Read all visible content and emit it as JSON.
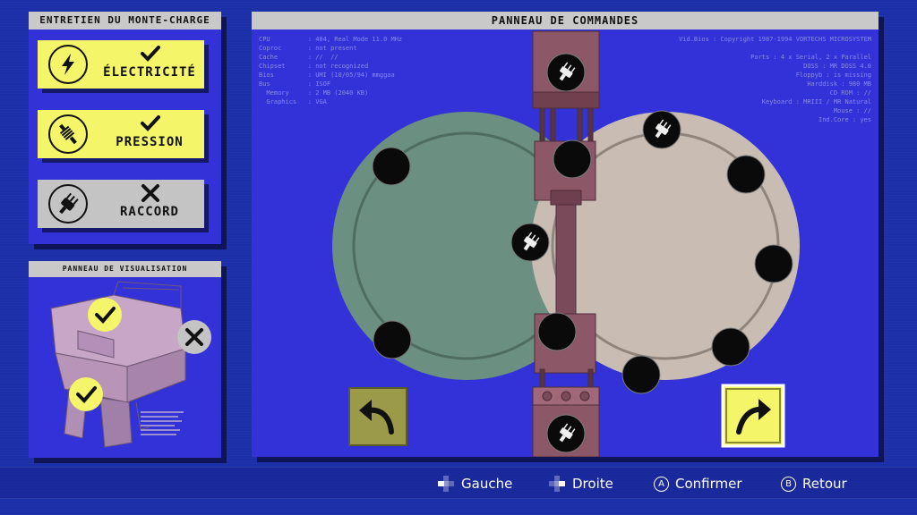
{
  "maintenance": {
    "title": "ENTRETIEN DU MONTE-CHARGE",
    "tasks": [
      {
        "label": "ÉLECTRICITÉ",
        "status": "done"
      },
      {
        "label": "PRESSION",
        "status": "done"
      },
      {
        "label": "RACCORD",
        "status": "failed"
      }
    ]
  },
  "visualization": {
    "title": "PANNEAU DE VISUALISATION"
  },
  "command_panel": {
    "title": "PANNEAU DE COMMANDES",
    "sysinfo_left": "CPU          : 404, Real Mode 11.0 MHz\nCoproc       : not present\nCache        : //  //\nChipset      : not recognized\nBios         : UMI (10/05/94) mmggaa\nBus          : ISOF\n  Memory     : 2 MB (2040 KB)\n  Graphics   : VGA",
    "sysinfo_right": "Vid.Bios : Copyright 1987-1994 VORTECHS MICROSYSTEM\n\nPorts : 4 x Serial, 2 x Parallel\nDOSS : MR DOSS 4.0\nFloppyb : is missing\nHarddisk : 980 MB\nCD ROM : //\nKeyboard : MRIII / MR Natural\nMouse : //\nInd.Core : yes"
  },
  "controls": {
    "left_label": "Gauche",
    "right_label": "Droite",
    "confirm_label": "Confirmer",
    "confirm_button": "A",
    "back_label": "Retour",
    "back_button": "B"
  },
  "colors": {
    "accent_yellow": "#f5f56a",
    "panel_blue": "#3232d8",
    "left_disc": "#6b8f80",
    "right_disc": "#c9bdb3",
    "mechanism": "#8c5868"
  }
}
